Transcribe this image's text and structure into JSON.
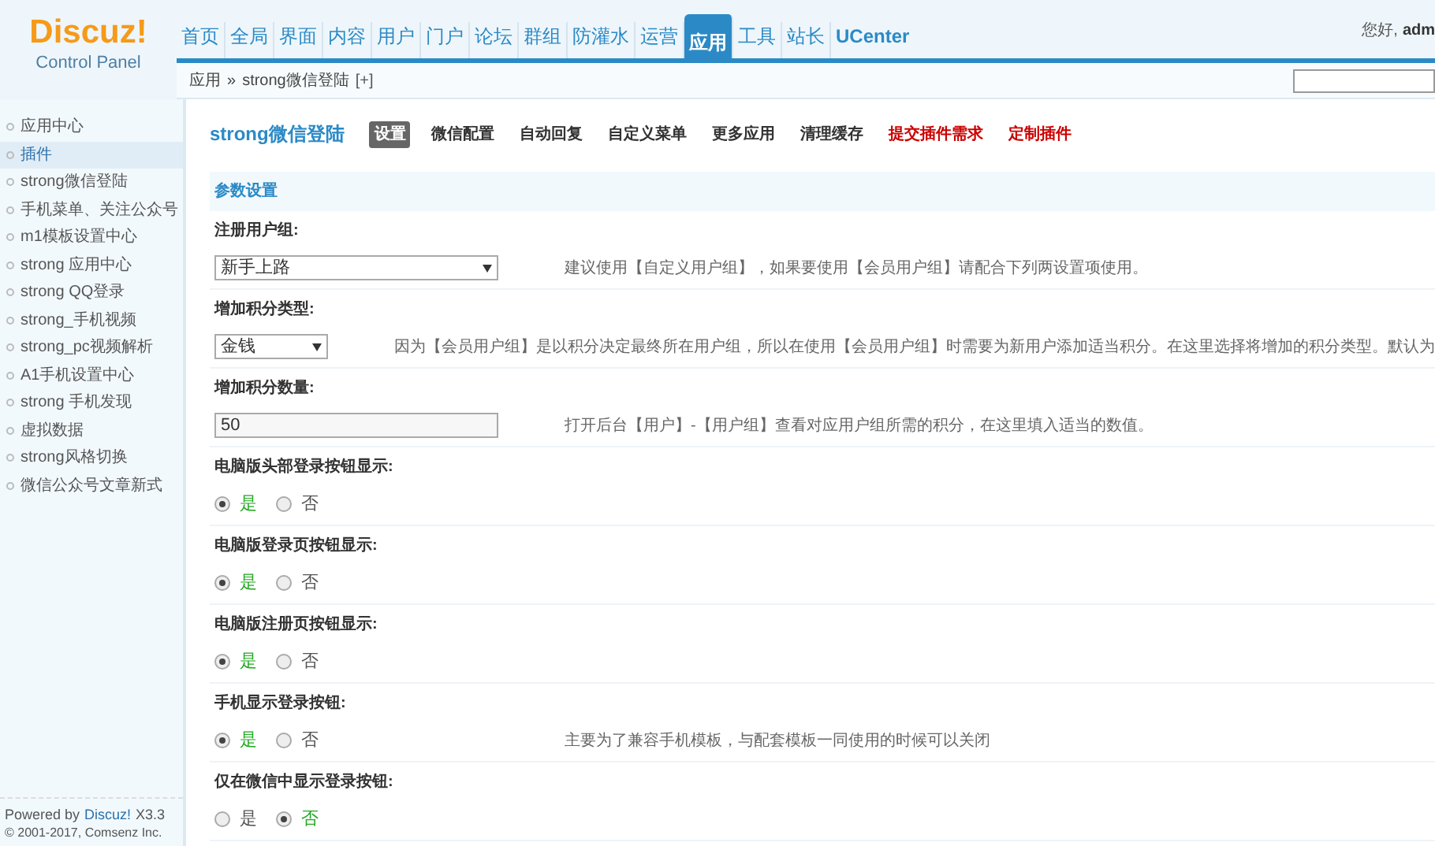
{
  "logo": {
    "name": "Discuz!",
    "subtitle": "Control Panel"
  },
  "nav": [
    {
      "label": "首页",
      "selected": false
    },
    {
      "label": "全局",
      "selected": false
    },
    {
      "label": "界面",
      "selected": false
    },
    {
      "label": "内容",
      "selected": false
    },
    {
      "label": "用户",
      "selected": false
    },
    {
      "label": "门户",
      "selected": false
    },
    {
      "label": "论坛",
      "selected": false
    },
    {
      "label": "群组",
      "selected": false
    },
    {
      "label": "防灌水",
      "selected": false
    },
    {
      "label": "运营",
      "selected": false
    },
    {
      "label": "应用",
      "selected": true
    },
    {
      "label": "工具",
      "selected": false
    },
    {
      "label": "站长",
      "selected": false
    },
    {
      "label": "UCenter",
      "selected": false
    }
  ],
  "greeting": {
    "text": "您好,",
    "user": "adm"
  },
  "breadcrumb": {
    "parent": "应用",
    "separator": "»",
    "current": "strong微信登陆",
    "add": "[+]"
  },
  "sidebar": {
    "items": [
      {
        "label": "应用中心",
        "selected": false
      },
      {
        "label": "插件",
        "selected": true
      },
      {
        "label": "strong微信登陆",
        "selected": false
      },
      {
        "label": "手机菜单、关注公众号",
        "selected": false
      },
      {
        "label": "m1模板设置中心",
        "selected": false
      },
      {
        "label": "strong 应用中心",
        "selected": false
      },
      {
        "label": "strong QQ登录",
        "selected": false
      },
      {
        "label": "strong_手机视频",
        "selected": false
      },
      {
        "label": "strong_pc视频解析",
        "selected": false
      },
      {
        "label": "A1手机设置中心",
        "selected": false
      },
      {
        "label": "strong 手机发现",
        "selected": false
      },
      {
        "label": "虚拟数据",
        "selected": false
      },
      {
        "label": "strong风格切换",
        "selected": false
      },
      {
        "label": "微信公众号文章新式",
        "selected": false
      }
    ],
    "footer": {
      "powered": "Powered by",
      "brand": "Discuz!",
      "version": "X3.3",
      "copyright": "© 2001-2017, Comsenz Inc."
    }
  },
  "plugin": {
    "title": "strong微信登陆",
    "tabs": [
      {
        "label": "设置",
        "selected": true,
        "highlight": false
      },
      {
        "label": "微信配置",
        "selected": false,
        "highlight": false
      },
      {
        "label": "自动回复",
        "selected": false,
        "highlight": false
      },
      {
        "label": "自定义菜单",
        "selected": false,
        "highlight": false
      },
      {
        "label": "更多应用",
        "selected": false,
        "highlight": false
      },
      {
        "label": "清理缓存",
        "selected": false,
        "highlight": false
      },
      {
        "label": "提交插件需求",
        "selected": false,
        "highlight": true
      },
      {
        "label": "定制插件",
        "selected": false,
        "highlight": true
      }
    ]
  },
  "section_title": "参数设置",
  "settings": [
    {
      "kind": "select",
      "label": "注册用户组:",
      "value": "新手上路",
      "description": "建议使用【自定义用户组】，如果要使用【会员用户组】请配合下列两设置项使用。"
    },
    {
      "kind": "select",
      "label": "增加积分类型:",
      "value": "金钱",
      "description": "因为【会员用户组】是以积分决定最终所在用户组，所以在使用【会员用户组】时需要为新用户添加适当积分。在这里选择将增加的积分类型。默认为"
    },
    {
      "kind": "text",
      "label": "增加积分数量:",
      "value": "50",
      "description": "打开后台【用户】-【用户组】查看对应用户组所需的积分，在这里填入适当的数值。"
    },
    {
      "kind": "radio",
      "label": "电脑版头部登录按钮显示:",
      "options": [
        {
          "label": "是",
          "selected": true
        },
        {
          "label": "否",
          "selected": false
        }
      ]
    },
    {
      "kind": "radio",
      "label": "电脑版登录页按钮显示:",
      "options": [
        {
          "label": "是",
          "selected": true
        },
        {
          "label": "否",
          "selected": false
        }
      ]
    },
    {
      "kind": "radio",
      "label": "电脑版注册页按钮显示:",
      "options": [
        {
          "label": "是",
          "selected": true
        },
        {
          "label": "否",
          "selected": false
        }
      ]
    },
    {
      "kind": "radio",
      "label": "手机显示登录按钮:",
      "options": [
        {
          "label": "是",
          "selected": true
        },
        {
          "label": "否",
          "selected": false
        }
      ],
      "description": "主要为了兼容手机模板，与配套模板一同使用的时候可以关闭"
    },
    {
      "kind": "radio",
      "label": "仅在微信中显示登录按钮:",
      "options": [
        {
          "label": "是",
          "selected": false
        },
        {
          "label": "否",
          "selected": true
        }
      ]
    }
  ]
}
